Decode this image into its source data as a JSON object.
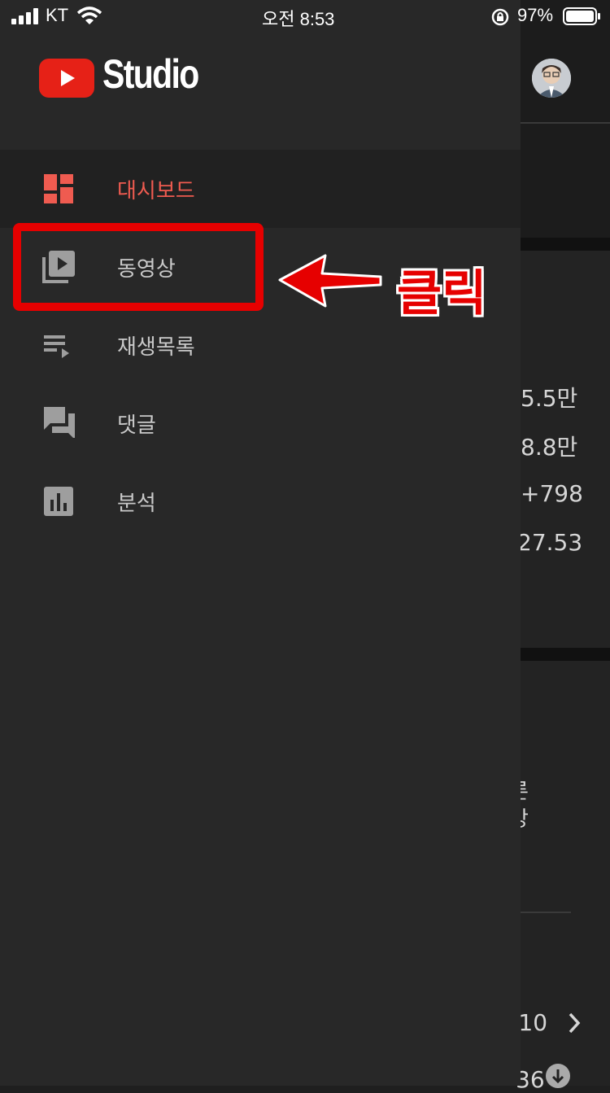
{
  "status_bar": {
    "carrier": "KT",
    "time": "오전 8:53",
    "battery": "97%"
  },
  "app": {
    "logo_text": "Studio",
    "brand_color": "#e62117",
    "active_color": "#ef5b50"
  },
  "nav": {
    "items": [
      {
        "label": "대시보드",
        "icon": "dashboard-icon",
        "active": true
      },
      {
        "label": "동영상",
        "icon": "video-library-icon",
        "active": false
      },
      {
        "label": "재생목록",
        "icon": "playlist-icon",
        "active": false
      },
      {
        "label": "댓글",
        "icon": "comments-icon",
        "active": false
      },
      {
        "label": "분석",
        "icon": "analytics-icon",
        "active": false
      }
    ]
  },
  "background_screen": {
    "stats": [
      "5.5만",
      "8.8만",
      "+798",
      "27.53"
    ],
    "partial_text_1": "른",
    "partial_text_2": "강",
    "pager": "/10",
    "bottom_partial": "36"
  },
  "annotation": {
    "label": "클릭",
    "color": "#e60000"
  }
}
